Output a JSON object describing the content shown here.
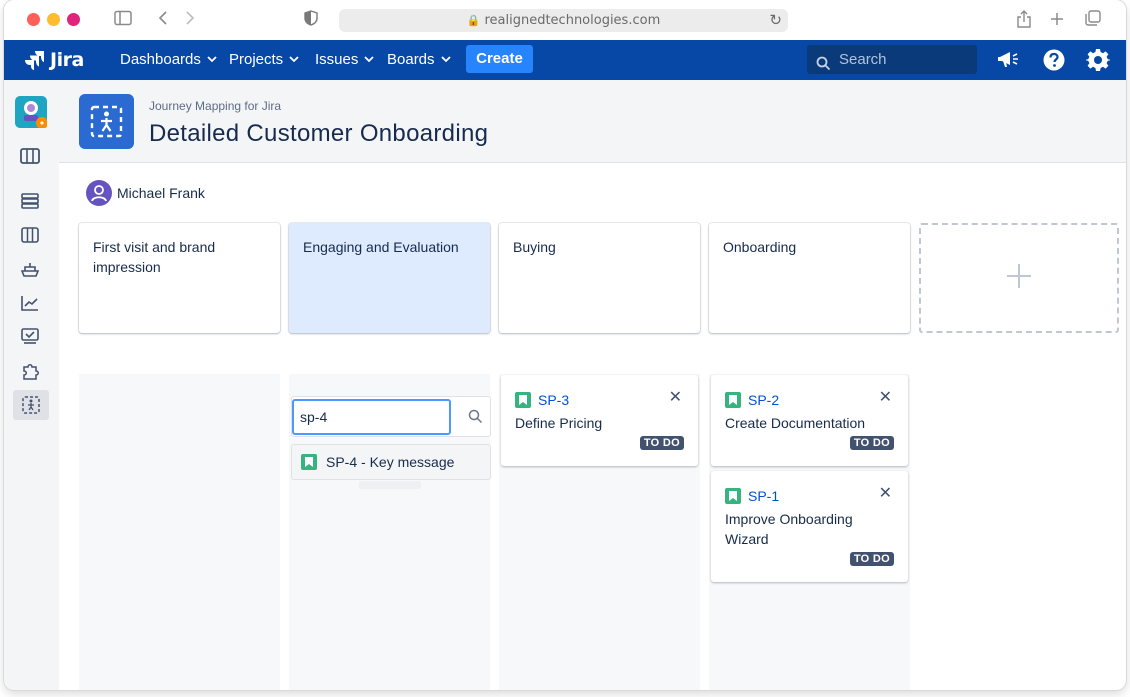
{
  "browser": {
    "url": "realignedtechnologies.com"
  },
  "nav": {
    "logo": "Jira",
    "items": [
      {
        "label": "Dashboards"
      },
      {
        "label": "Projects"
      },
      {
        "label": "Issues"
      },
      {
        "label": "Boards"
      }
    ],
    "create": "Create",
    "search_placeholder": "Search"
  },
  "header": {
    "app_name": "Journey Mapping for Jira",
    "title": "Detailed Customer Onboarding"
  },
  "user": {
    "name": "Michael Frank"
  },
  "stages": [
    {
      "label": "First visit and brand impression",
      "selected": false
    },
    {
      "label": "Engaging and Evaluation",
      "selected": true
    },
    {
      "label": "Buying",
      "selected": false
    },
    {
      "label": "Onboarding",
      "selected": false
    }
  ],
  "column_search": {
    "value": "sp-4",
    "suggestion": "SP-4 - Key message"
  },
  "issues": [
    {
      "key": "SP-3",
      "summary": "Define Pricing",
      "status": "TO DO"
    },
    {
      "key": "SP-2",
      "summary": "Create Documentation",
      "status": "TO DO"
    },
    {
      "key": "SP-1",
      "summary": "Improve Onboarding Wizard",
      "status": "TO DO"
    }
  ],
  "colors": {
    "nav_bg": "#0747a6",
    "create_btn": "#2684ff",
    "selected_stage": "#deebff",
    "story_icon": "#36b37e",
    "status_badge": "#42526e"
  }
}
